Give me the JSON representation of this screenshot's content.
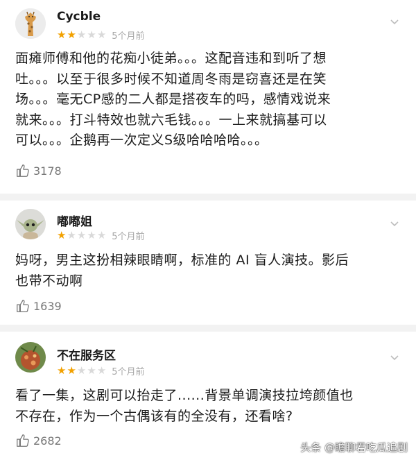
{
  "reviews": [
    {
      "username": "Cycble",
      "avatar_icon": "giraffe-avatar-icon",
      "rating": 2,
      "max_rating": 5,
      "time": "5个月前",
      "content": "面瘫师傅和他的花痴小徒弟。。。这配音违和到听了想\n吐。。。以至于很多时候不知道周冬雨是窃喜还是在笑\n场。。。毫无CP感的二人都是搭夜车的吗，感情戏说来\n就来。。。打斗特效也就六毛钱。。。一上来就搞基可以\n可以。。。企鹅再一次定义S级哈哈哈哈。。。",
      "likes": "3178"
    },
    {
      "username": "嘟嘟姐",
      "avatar_icon": "baby-yoda-avatar-icon",
      "rating": 1,
      "max_rating": 5,
      "time": "5个月前",
      "content": "妈呀，男主这扮相辣眼睛啊，标准的 AI 盲人演技。影后\n也带不动啊",
      "likes": "1639"
    },
    {
      "username": "不在服务区",
      "avatar_icon": "food-avatar-icon",
      "rating": 2,
      "max_rating": 5,
      "time": "5个月前",
      "content": "看了一集，这剧可以抬走了......背景单调演技拉垮颜值也\n不存在，作为一个古偶该有的全没有，还看啥?",
      "likes": "2682"
    }
  ],
  "watermark": "头条 @瞻聊君吃瓜追剧",
  "colors": {
    "star_on": "#f2a100",
    "star_off": "#d9d9d9",
    "separator": "#f2f2f2",
    "muted_text": "#a6a6a6"
  }
}
